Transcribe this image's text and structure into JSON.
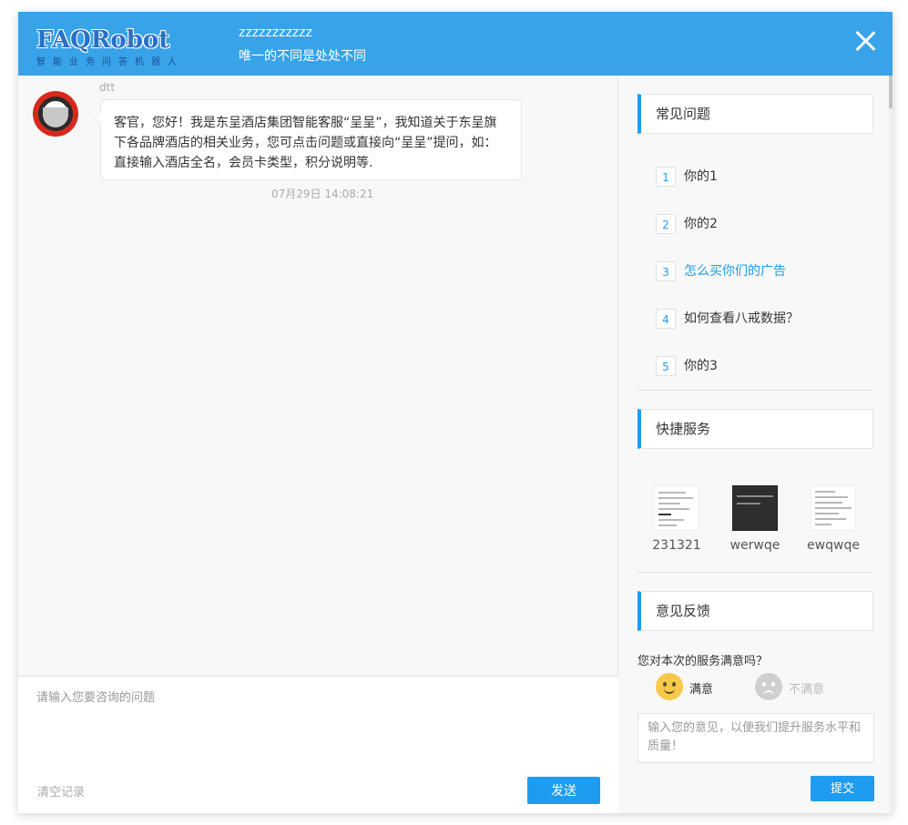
{
  "header": {
    "logo_text": "FAQRobot",
    "logo_subtitle": "智能业务问答机器人",
    "title": "zzzzzzzzzzz",
    "subtitle": "唯一的不同是处处不同"
  },
  "chat": {
    "messages": [
      {
        "sender": "dtt",
        "text": "客官，您好！我是东呈酒店集团智能客服“呈呈”，我知道关于东呈旗下各品牌酒店的相关业务，您可点击问题或直接向“呈呈”提问，如：直接输入酒店全名，会员卡类型，积分说明等.",
        "time": "07月29日 14:08:21"
      }
    ],
    "input_placeholder": "请输入您要咨询的问题",
    "clear_label": "清空记录",
    "send_label": "发送"
  },
  "sidebar": {
    "faq": {
      "title": "常见问题",
      "items": [
        {
          "num": "1",
          "label": "你的1",
          "active": false
        },
        {
          "num": "2",
          "label": "你的2",
          "active": false
        },
        {
          "num": "3",
          "label": "怎么买你们的广告",
          "active": true
        },
        {
          "num": "4",
          "label": "如何查看八戒数据？",
          "active": false
        },
        {
          "num": "5",
          "label": "你的3",
          "active": false
        }
      ]
    },
    "quick_service": {
      "title": "快捷服务",
      "items": [
        {
          "label": "231321",
          "theme": "light"
        },
        {
          "label": "werwqe",
          "theme": "dark"
        },
        {
          "label": "ewqwqe",
          "theme": "light"
        }
      ]
    },
    "feedback": {
      "title": "意见反馈",
      "question": "您对本次的服务满意吗？",
      "satisfied_label": "满意",
      "unsatisfied_label": "不满意",
      "input_placeholder": "输入您的意见，以便我们提升服务水平和质量！",
      "submit_label": "提交"
    }
  },
  "colors": {
    "header_bg": "#38a3e8",
    "accent": "#1e9cf0"
  }
}
